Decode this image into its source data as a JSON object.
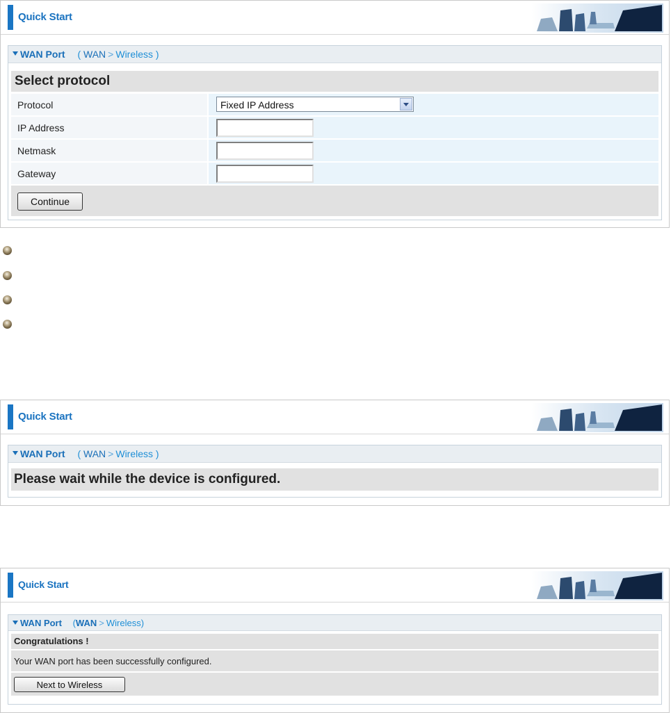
{
  "panel1": {
    "header": {
      "title": "Quick Start"
    },
    "section": {
      "title": "WAN Port",
      "crumb_open": "(",
      "crumb_wan": "WAN",
      "crumb_sep": ">",
      "crumb_next": "Wireless",
      "crumb_close": ")"
    },
    "heading": "Select protocol",
    "protocol": {
      "label": "Protocol",
      "value": "Fixed IP Address"
    },
    "ip_address": {
      "label": "IP Address",
      "value": ""
    },
    "netmask": {
      "label": "Netmask",
      "value": ""
    },
    "gateway": {
      "label": "Gateway",
      "value": ""
    },
    "continue_label": "Continue"
  },
  "bullets": {
    "count": 4
  },
  "panel2": {
    "header": {
      "title": "Quick Start"
    },
    "section": {
      "title": "WAN Port",
      "crumb_open": "(",
      "crumb_wan": "WAN",
      "crumb_sep": ">",
      "crumb_next": "Wireless",
      "crumb_close": ")"
    },
    "message": "Please wait while the device is configured."
  },
  "panel3": {
    "header": {
      "title": "Quick Start"
    },
    "section": {
      "title": "WAN Port",
      "crumb_open": "(",
      "crumb_wan": "WAN",
      "crumb_sep": ">",
      "crumb_next": "Wireless)",
      "crumb_close": ""
    },
    "congrats": "Congratulations !",
    "message": "Your WAN port has been successfully configured.",
    "next_label": "Next to Wireless"
  },
  "colors": {
    "brand_blue": "#1a73c0",
    "header_bar": "#1a76c4",
    "row_gray": "#e1e1e1",
    "value_cell": "#e9f4fb"
  },
  "icons": {
    "banner": "office-chairs-banner-icon",
    "bullet": "bronze-bullet-icon",
    "section": "triangle-down-icon"
  }
}
